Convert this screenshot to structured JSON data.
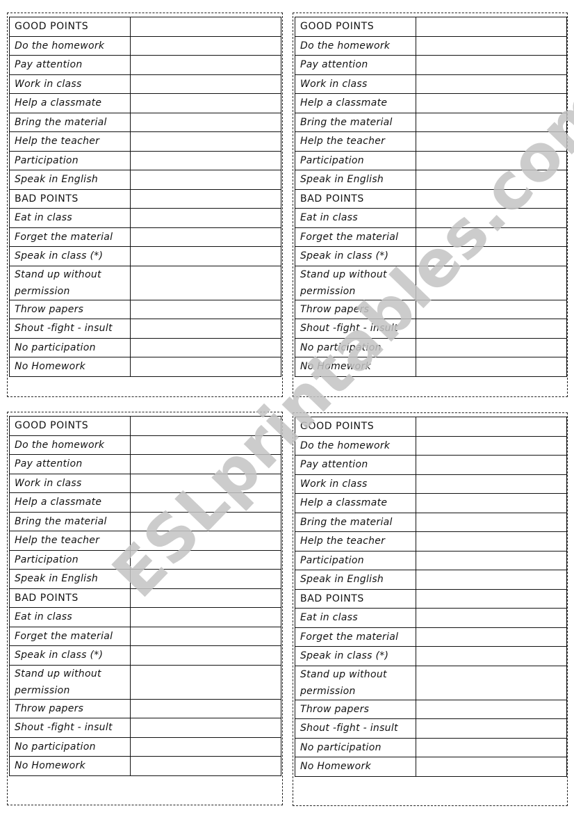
{
  "document": {
    "cards": [
      {
        "rows": [
          {
            "label": "GOOD POINTS",
            "value": "",
            "header": true
          },
          {
            "label": "Do the homework",
            "value": ""
          },
          {
            "label": "Pay attention",
            "value": ""
          },
          {
            "label": "Work in class",
            "value": ""
          },
          {
            "label": "Help a classmate",
            "value": ""
          },
          {
            "label": "Bring the material",
            "value": ""
          },
          {
            "label": "Help the teacher",
            "value": ""
          },
          {
            "label": "Participation",
            "value": ""
          },
          {
            "label": "Speak in English",
            "value": ""
          },
          {
            "label": "BAD POINTS",
            "value": "",
            "header": true
          },
          {
            "label": "Eat in  class",
            "value": ""
          },
          {
            "label": "Forget the material",
            "value": ""
          },
          {
            "label": "Speak in class (*)",
            "value": ""
          },
          {
            "label": "Stand up without permission",
            "value": "",
            "tall": true
          },
          {
            "label": "Throw papers",
            "value": ""
          },
          {
            "label": "Shout  -fight - insult",
            "value": ""
          },
          {
            "label": "No participation",
            "value": ""
          },
          {
            "label": "No Homework",
            "value": ""
          }
        ]
      },
      {
        "rows": [
          {
            "label": "GOOD POINTS",
            "value": "",
            "header": true
          },
          {
            "label": "Do the homework",
            "value": ""
          },
          {
            "label": "Pay attention",
            "value": ""
          },
          {
            "label": "Work in class",
            "value": ""
          },
          {
            "label": "Help a classmate",
            "value": ""
          },
          {
            "label": "Bring the material",
            "value": ""
          },
          {
            "label": "Help the teacher",
            "value": ""
          },
          {
            "label": "Participation",
            "value": ""
          },
          {
            "label": "Speak in English",
            "value": ""
          },
          {
            "label": "BAD POINTS",
            "value": "",
            "header": true
          },
          {
            "label": "Eat in  class",
            "value": ""
          },
          {
            "label": "Forget the material",
            "value": ""
          },
          {
            "label": "Speak in class (*)",
            "value": ""
          },
          {
            "label": "Stand up without permission",
            "value": "",
            "tall": true
          },
          {
            "label": "Throw papers",
            "value": ""
          },
          {
            "label": "Shout  -fight - insult",
            "value": ""
          },
          {
            "label": "No participation",
            "value": ""
          },
          {
            "label": "No Homework",
            "value": ""
          }
        ]
      },
      {
        "rows": [
          {
            "label": "GOOD POINTS",
            "value": "",
            "header": true
          },
          {
            "label": "Do the homework",
            "value": ""
          },
          {
            "label": "Pay attention",
            "value": ""
          },
          {
            "label": "Work in class",
            "value": ""
          },
          {
            "label": "Help a classmate",
            "value": ""
          },
          {
            "label": "Bring the material",
            "value": ""
          },
          {
            "label": "Help the teacher",
            "value": ""
          },
          {
            "label": "Participation",
            "value": ""
          },
          {
            "label": "Speak in English",
            "value": ""
          },
          {
            "label": "BAD POINTS",
            "value": "",
            "header": true
          },
          {
            "label": "Eat in  class",
            "value": ""
          },
          {
            "label": "Forget the material",
            "value": ""
          },
          {
            "label": "Speak in class (*)",
            "value": ""
          },
          {
            "label": "Stand up without permission",
            "value": "",
            "tall": true
          },
          {
            "label": "Throw papers",
            "value": ""
          },
          {
            "label": "Shout  -fight - insult",
            "value": ""
          },
          {
            "label": "No participation",
            "value": ""
          },
          {
            "label": "No Homework",
            "value": ""
          }
        ]
      },
      {
        "rows": [
          {
            "label": "GOOD POINTS",
            "value": "",
            "header": true
          },
          {
            "label": "Do the homework",
            "value": ""
          },
          {
            "label": "Pay attention",
            "value": ""
          },
          {
            "label": "Work in class",
            "value": ""
          },
          {
            "label": "Help a classmate",
            "value": ""
          },
          {
            "label": "Bring the material",
            "value": ""
          },
          {
            "label": "Help the teacher",
            "value": ""
          },
          {
            "label": "Participation",
            "value": ""
          },
          {
            "label": "Speak in English",
            "value": ""
          },
          {
            "label": "BAD POINTS",
            "value": "",
            "header": true
          },
          {
            "label": "Eat in  class",
            "value": ""
          },
          {
            "label": "Forget the material",
            "value": ""
          },
          {
            "label": "Speak in class (*)",
            "value": ""
          },
          {
            "label": "Stand up without permission",
            "value": "",
            "tall": true
          },
          {
            "label": "Throw papers",
            "value": ""
          },
          {
            "label": "Shout  -fight - insult",
            "value": ""
          },
          {
            "label": "No participation",
            "value": ""
          },
          {
            "label": "No Homework",
            "value": ""
          }
        ]
      }
    ],
    "watermark": "ESLprintables.com",
    "colors": {
      "text": "#111111",
      "border": "#111111",
      "watermark": "#c4c4c4",
      "background": "#ffffff"
    }
  }
}
